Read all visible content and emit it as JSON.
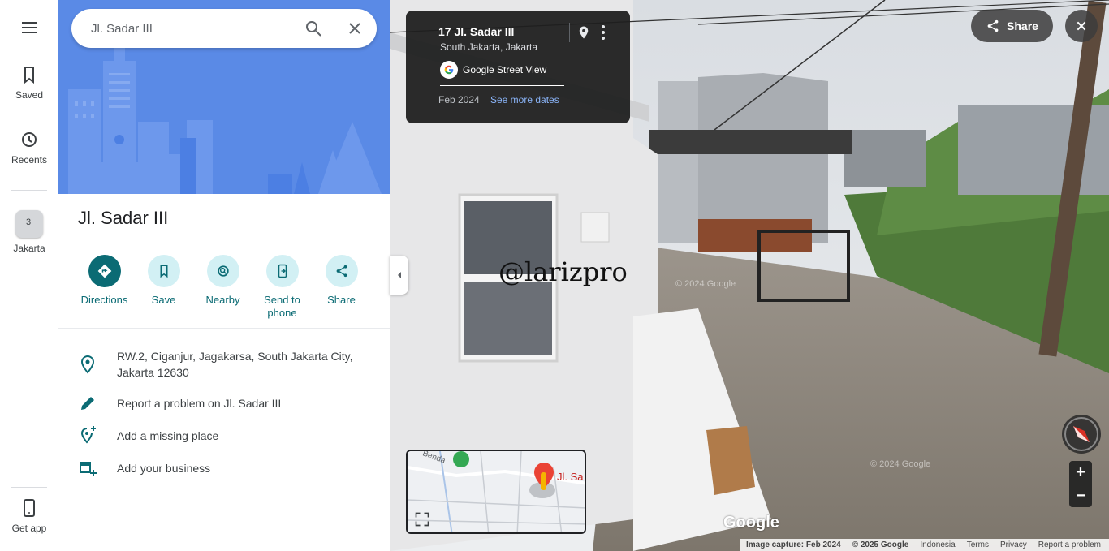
{
  "rail": {
    "menu_icon": "hamburger-menu-icon",
    "items": [
      {
        "label": "Saved",
        "icon": "bookmark-icon"
      },
      {
        "label": "Recents",
        "icon": "history-icon"
      },
      {
        "label": "Jakarta",
        "icon": "recent-place-thumbnail"
      }
    ],
    "badge": "3",
    "get_app_label": "Get app"
  },
  "search": {
    "value": "Jl. Sadar III"
  },
  "place": {
    "title": "Jl. Sadar III",
    "actions": [
      {
        "label": "Directions",
        "icon": "directions-icon"
      },
      {
        "label": "Save",
        "icon": "bookmark-icon"
      },
      {
        "label": "Nearby",
        "icon": "nearby-icon"
      },
      {
        "label": "Send to phone",
        "icon": "send-to-phone-icon"
      },
      {
        "label": "Share",
        "icon": "share-icon"
      }
    ],
    "info": [
      {
        "text": "RW.2, Ciganjur, Jagakarsa, South Jakarta City, Jakarta 12630",
        "icon": "location-pin-icon"
      },
      {
        "text": "Report a problem on Jl. Sadar III",
        "icon": "pencil-icon"
      },
      {
        "text": "Add a missing place",
        "icon": "add-location-icon"
      },
      {
        "text": "Add your business",
        "icon": "add-business-icon"
      }
    ]
  },
  "streetview": {
    "card": {
      "address": "17 Jl. Sadar III",
      "city": "South Jakarta, Jakarta",
      "brand": "Google Street View",
      "date": "Feb 2024",
      "see_more": "See more dates"
    },
    "share_label": "Share",
    "watermark": "@larizpro",
    "faint_copyright": "© 2024 Google",
    "minimap_label": "Jl. Sa",
    "minimap_road": "Benda",
    "google_logo": "Google",
    "footer": {
      "capture": "Image capture: Feb 2024",
      "copyright": "© 2025 Google",
      "country": "Indonesia",
      "terms": "Terms",
      "privacy": "Privacy",
      "report": "Report a problem"
    }
  },
  "colors": {
    "accent": "#0b6b74",
    "accent_light": "#d2f0f4",
    "hero_blue": "#5a8ae6",
    "link_blue": "#8ab4f8"
  }
}
